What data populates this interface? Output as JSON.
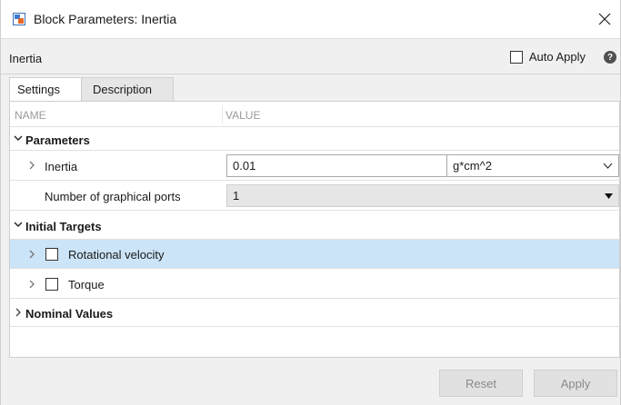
{
  "window": {
    "title": "Block Parameters: Inertia"
  },
  "header": {
    "block_name": "Inertia",
    "auto_apply_label": "Auto Apply",
    "auto_apply_checked": false,
    "help_glyph": "?"
  },
  "tabs": [
    {
      "label": "Settings",
      "active": true
    },
    {
      "label": "Description",
      "active": false
    }
  ],
  "columns": {
    "name": "NAME",
    "value": "VALUE"
  },
  "sections": {
    "parameters": {
      "label": "Parameters",
      "expanded": true,
      "inertia": {
        "label": "Inertia",
        "value": "0.01",
        "unit": "g*cm^2"
      },
      "ports": {
        "label": "Number of graphical ports",
        "value": "1"
      }
    },
    "initial_targets": {
      "label": "Initial Targets",
      "expanded": true,
      "rotational_velocity": {
        "label": "Rotational velocity",
        "checked": false,
        "selected": true
      },
      "torque": {
        "label": "Torque",
        "checked": false
      }
    },
    "nominal_values": {
      "label": "Nominal Values",
      "expanded": false
    }
  },
  "footer": {
    "reset_label": "Reset",
    "apply_label": "Apply"
  },
  "colors": {
    "selection": "#cce4f7",
    "icon_blue": "#3b7bd4",
    "icon_orange": "#e2672a"
  }
}
